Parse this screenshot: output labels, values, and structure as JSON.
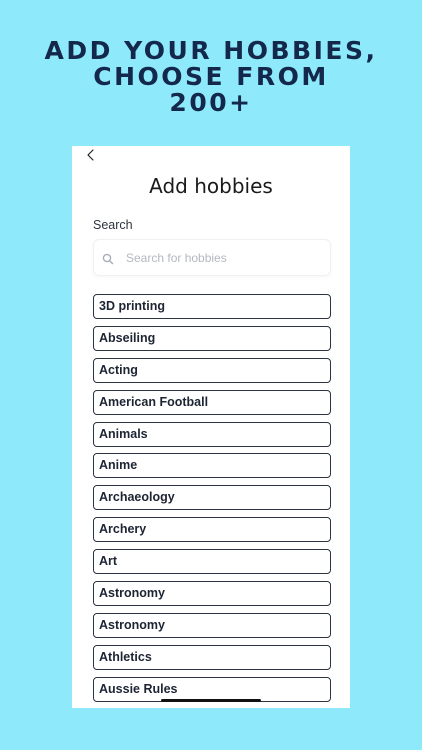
{
  "promo": {
    "line1": "ADD YOUR HOBBIES,",
    "line2": "CHOOSE FROM",
    "line3": "200+"
  },
  "screen": {
    "title": "Add hobbies",
    "back_icon": "chevron-left-icon"
  },
  "search": {
    "label": "Search",
    "placeholder": "Search for hobbies",
    "icon": "search-icon"
  },
  "hobbies": [
    "3D printing",
    "Abseiling",
    "Acting",
    "American Football",
    "Animals",
    "Anime",
    "Archaeology",
    "Archery",
    "Art",
    "Astronomy",
    "Astronomy",
    "Athletics",
    "Aussie Rules"
  ],
  "colors": {
    "background": "#8ee9fb",
    "headline": "#13284a",
    "item_border": "#2b3442"
  }
}
